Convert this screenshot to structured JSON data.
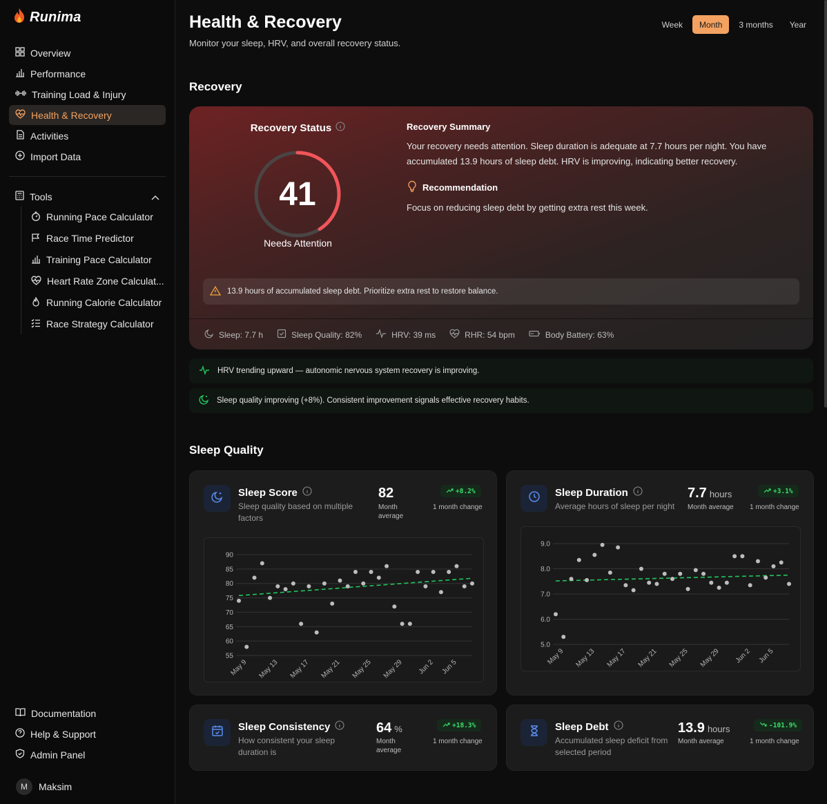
{
  "brand": {
    "name": "Runima"
  },
  "nav": {
    "items": [
      {
        "label": "Overview",
        "icon": "grid-icon"
      },
      {
        "label": "Performance",
        "icon": "bar-chart-icon"
      },
      {
        "label": "Training Load & Injury",
        "icon": "dumbbell-icon"
      },
      {
        "label": "Health & Recovery",
        "icon": "heart-pulse-icon"
      },
      {
        "label": "Activities",
        "icon": "file-icon"
      },
      {
        "label": "Import Data",
        "icon": "plus-circle-icon"
      }
    ],
    "tools_label": "Tools",
    "tools": [
      {
        "label": "Running Pace Calculator"
      },
      {
        "label": "Race Time Predictor"
      },
      {
        "label": "Training Pace Calculator"
      },
      {
        "label": "Heart Rate Zone Calculat..."
      },
      {
        "label": "Running Calorie Calculator"
      },
      {
        "label": "Race Strategy Calculator"
      }
    ],
    "bottom": [
      {
        "label": "Documentation"
      },
      {
        "label": "Help & Support"
      },
      {
        "label": "Admin Panel"
      }
    ],
    "user": {
      "initial": "M",
      "name": "Maksim"
    }
  },
  "header": {
    "title": "Health & Recovery",
    "subtitle": "Monitor your sleep, HRV, and overall recovery status.",
    "ranges": [
      "Week",
      "Month",
      "3 months",
      "Year"
    ],
    "active_range": "Month"
  },
  "recovery": {
    "section_title": "Recovery",
    "status_title": "Recovery Status",
    "score": "41",
    "score_fraction": 0.41,
    "status_label": "Needs Attention",
    "summary_title": "Recovery Summary",
    "summary_text": "Your recovery needs attention. Sleep duration is adequate at 7.7 hours per night. You have accumulated 13.9 hours of sleep debt. HRV is improving, indicating better recovery.",
    "recommendation_title": "Recommendation",
    "recommendation_text": "Focus on reducing sleep debt by getting extra rest this week.",
    "warning": "13.9 hours of accumulated sleep debt. Prioritize extra rest to restore balance.",
    "metrics": {
      "sleep": "Sleep: 7.7 h",
      "quality": "Sleep Quality: 82%",
      "hrv": "HRV: 39 ms",
      "rhr": "RHR: 54 bpm",
      "battery": "Body Battery: 63%"
    },
    "colors": {
      "accent": "#f2555a",
      "track": "#4a4545"
    }
  },
  "insights": [
    "HRV trending upward — autonomic nervous system recovery is improving.",
    "Sleep quality improving (+8%). Consistent improvement signals effective recovery habits."
  ],
  "sleep": {
    "section_title": "Sleep Quality",
    "score": {
      "title": "Sleep Score",
      "desc": "Sleep quality based on multiple factors",
      "value": "82",
      "unit": "",
      "value_label": "Month average",
      "change": "+8.2%",
      "change_label": "1 month change"
    },
    "duration": {
      "title": "Sleep Duration",
      "desc": "Average hours of sleep per night",
      "value": "7.7",
      "unit": "hours",
      "value_label": "Month average",
      "change": "+3.1%",
      "change_label": "1 month change"
    },
    "consistency": {
      "title": "Sleep Consistency",
      "desc": "How consistent your sleep duration is",
      "value": "64",
      "unit": "%",
      "value_label": "Month average",
      "change": "+18.3%",
      "change_label": "1 month change"
    },
    "debt": {
      "title": "Sleep Debt",
      "desc": "Accumulated sleep deficit from selected period",
      "value": "13.9",
      "unit": "hours",
      "value_label": "Month average",
      "change": "-101.9%",
      "change_label": "1 month change"
    }
  },
  "chart_data": [
    {
      "type": "scatter",
      "title": "Sleep Score",
      "x": [
        "May 8",
        "May 9",
        "May 10",
        "May 11",
        "May 12",
        "May 13",
        "May 14",
        "May 15",
        "May 16",
        "May 17",
        "May 18",
        "May 19",
        "May 20",
        "May 21",
        "May 22",
        "May 23",
        "May 24",
        "May 25",
        "May 26",
        "May 27",
        "May 28",
        "May 29",
        "May 30",
        "May 31",
        "Jun 1",
        "Jun 2",
        "Jun 3",
        "Jun 4",
        "Jun 5",
        "Jun 6",
        "Jun 7"
      ],
      "y": [
        74,
        58,
        82,
        87,
        75,
        79,
        78,
        80,
        66,
        79,
        63,
        80,
        73,
        81,
        79,
        84,
        80,
        84,
        82,
        86,
        72,
        66,
        66,
        84,
        79,
        84,
        77,
        84,
        86,
        79,
        80
      ],
      "trend": {
        "start": 75.8,
        "end": 81.8
      },
      "x_ticks": [
        "May 9",
        "May 13",
        "May 17",
        "May 21",
        "May 25",
        "May 29",
        "Jun 2",
        "Jun 5"
      ],
      "ylim": [
        55,
        90
      ],
      "y_ticks": [
        55,
        60,
        65,
        70,
        75,
        80,
        85,
        90
      ],
      "grid": true,
      "colors": {
        "point": "#bdbdbd",
        "trend": "#22c55e"
      }
    },
    {
      "type": "scatter",
      "title": "Sleep Duration",
      "x": [
        "May 8",
        "May 9",
        "May 10",
        "May 11",
        "May 12",
        "May 13",
        "May 14",
        "May 15",
        "May 16",
        "May 17",
        "May 18",
        "May 19",
        "May 20",
        "May 21",
        "May 22",
        "May 23",
        "May 24",
        "May 25",
        "May 26",
        "May 27",
        "May 28",
        "May 29",
        "May 30",
        "May 31",
        "Jun 1",
        "Jun 2",
        "Jun 3",
        "Jun 4",
        "Jun 5",
        "Jun 6",
        "Jun 7"
      ],
      "y": [
        6.2,
        5.3,
        7.6,
        8.35,
        7.55,
        8.55,
        8.95,
        7.85,
        8.85,
        7.35,
        7.15,
        8.0,
        7.45,
        7.4,
        7.8,
        7.6,
        7.8,
        7.2,
        7.95,
        7.8,
        7.45,
        7.25,
        7.45,
        8.5,
        8.5,
        7.35,
        8.3,
        7.65,
        8.1,
        8.25,
        7.4
      ],
      "trend": {
        "start": 7.52,
        "end": 7.75
      },
      "x_ticks": [
        "May 9",
        "May 13",
        "May 17",
        "May 21",
        "May 25",
        "May 29",
        "Jun 2",
        "Jun 5"
      ],
      "ylim": [
        5.0,
        9.0
      ],
      "y_ticks": [
        "5.0",
        "6.0",
        "7.0",
        "8.0",
        "9.0"
      ],
      "grid": true,
      "colors": {
        "point": "#bdbdbd",
        "trend": "#22c55e"
      }
    }
  ]
}
